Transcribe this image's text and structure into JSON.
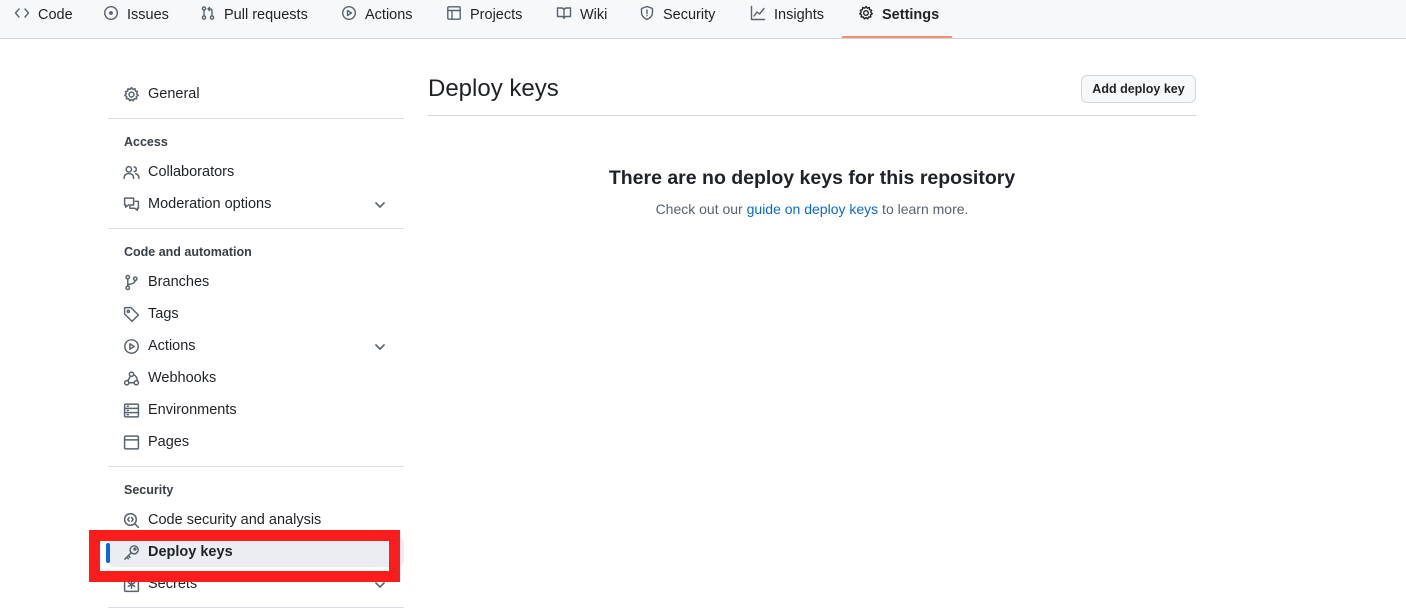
{
  "tabs": [
    {
      "label": "Code",
      "icon": "code-icon"
    },
    {
      "label": "Issues",
      "icon": "issue-opened-icon"
    },
    {
      "label": "Pull requests",
      "icon": "git-pull-request-icon"
    },
    {
      "label": "Actions",
      "icon": "play-icon"
    },
    {
      "label": "Projects",
      "icon": "table-icon"
    },
    {
      "label": "Wiki",
      "icon": "book-icon"
    },
    {
      "label": "Security",
      "icon": "shield-icon"
    },
    {
      "label": "Insights",
      "icon": "graph-icon"
    },
    {
      "label": "Settings",
      "icon": "gear-icon",
      "active": true
    }
  ],
  "sidebar": {
    "general": "General",
    "access_heading": "Access",
    "collaborators": "Collaborators",
    "moderation": "Moderation options",
    "code_heading": "Code and automation",
    "branches": "Branches",
    "tags": "Tags",
    "actions": "Actions",
    "webhooks": "Webhooks",
    "environments": "Environments",
    "pages": "Pages",
    "security_heading": "Security",
    "code_security": "Code security and analysis",
    "deploy_keys": "Deploy keys",
    "secrets": "Secrets"
  },
  "main": {
    "title": "Deploy keys",
    "add_button": "Add deploy key",
    "blank_title": "There are no deploy keys for this repository",
    "blank_desc_prefix": "Check out our ",
    "blank_desc_link": "guide on deploy keys",
    "blank_desc_suffix": " to learn more."
  },
  "colors": {
    "accent": "#0969da",
    "tab_underline": "#fd8c73",
    "highlight": "#fd1d1d"
  }
}
